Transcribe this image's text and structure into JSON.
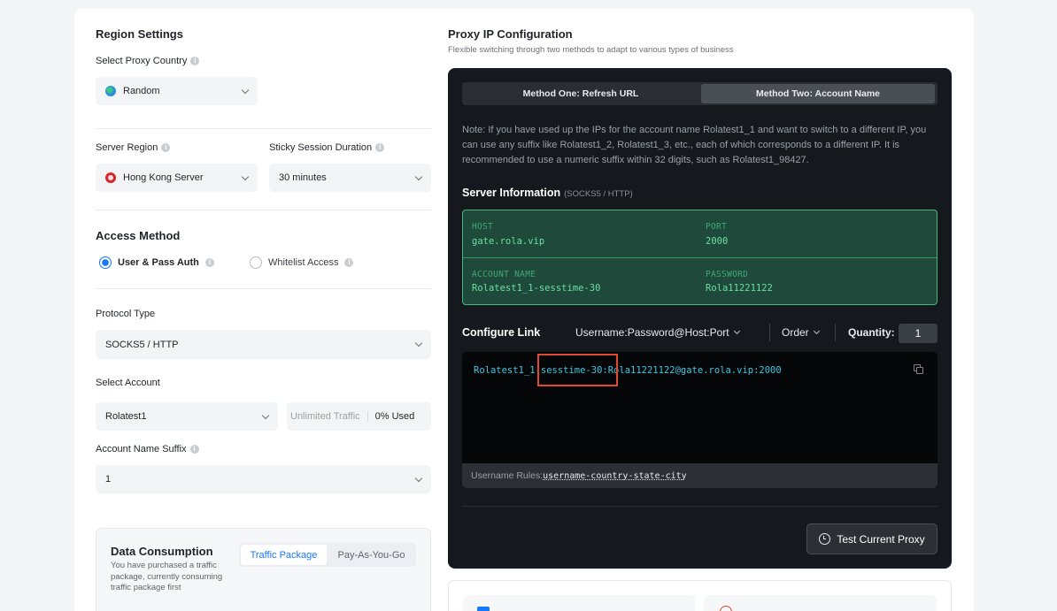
{
  "left": {
    "region_settings_title": "Region Settings",
    "proxy_country_label": "Select Proxy Country",
    "proxy_country_value": "Random",
    "server_region_label": "Server Region",
    "server_region_value": "Hong Kong Server",
    "sticky_label": "Sticky Session Duration",
    "sticky_value": "30 minutes",
    "access_method_title": "Access Method",
    "access_option_1": "User & Pass Auth",
    "access_option_2": "Whitelist Access",
    "protocol_label": "Protocol Type",
    "protocol_value": "SOCKS5 / HTTP",
    "account_label": "Select Account",
    "account_value": "Rolatest1",
    "traffic_label": "Unlimited Traffic",
    "traffic_used": "0% Used",
    "suffix_label": "Account Name Suffix",
    "suffix_value": "1",
    "data_consumption_title": "Data Consumption",
    "data_consumption_desc": "You have purchased a traffic package, currently consuming traffic package first",
    "tab_traffic": "Traffic Package",
    "tab_payg": "Pay-As-You-Go"
  },
  "right": {
    "title": "Proxy IP Configuration",
    "subtitle": "Flexible switching through two methods to adapt to various types of business",
    "method_one": "Method One: Refresh URL",
    "method_two": "Method Two: Account Name",
    "note": "Note: If you have used up the IPs for the account name Rolatest1_1 and want to switch to a different IP, you can use any suffix like Rolatest1_2, Rolatest1_3, etc., each of which corresponds to a different IP. It is recommended to use a numeric suffix within 32 digits, such as Rolatest1_98427.",
    "server_info_title": "Server Information",
    "server_info_sub": "(SOCKS5 / HTTP)",
    "host_label": "HOST",
    "host_value": "gate.rola.vip",
    "port_label": "PORT",
    "port_value": "2000",
    "account_name_label": "ACCOUNT NAME",
    "account_name_value": "Rolatest1_1-sesstime-30",
    "password_label": "PASSWORD",
    "password_value": "Rola11221122",
    "configure_link_title": "Configure Link",
    "format_value": "Username:Password@Host:Port",
    "order_label": "Order",
    "quantity_label": "Quantity:",
    "quantity_value": "1",
    "link_part1": "Rolatest1_1",
    "link_part2": "-sesstime-30:",
    "link_part3": "Rola11221122@gate.rola.vip:2000",
    "username_rules_label": "Username Rules:",
    "username_rules_value": "username-country-state-city",
    "test_button": "Test Current Proxy"
  },
  "colors": {
    "accent_blue": "#1677ff",
    "dark_panel": "#15181c",
    "server_green": "#67e0a3",
    "link_cyan": "#3fc5e0",
    "highlight_red": "#e0492f"
  }
}
